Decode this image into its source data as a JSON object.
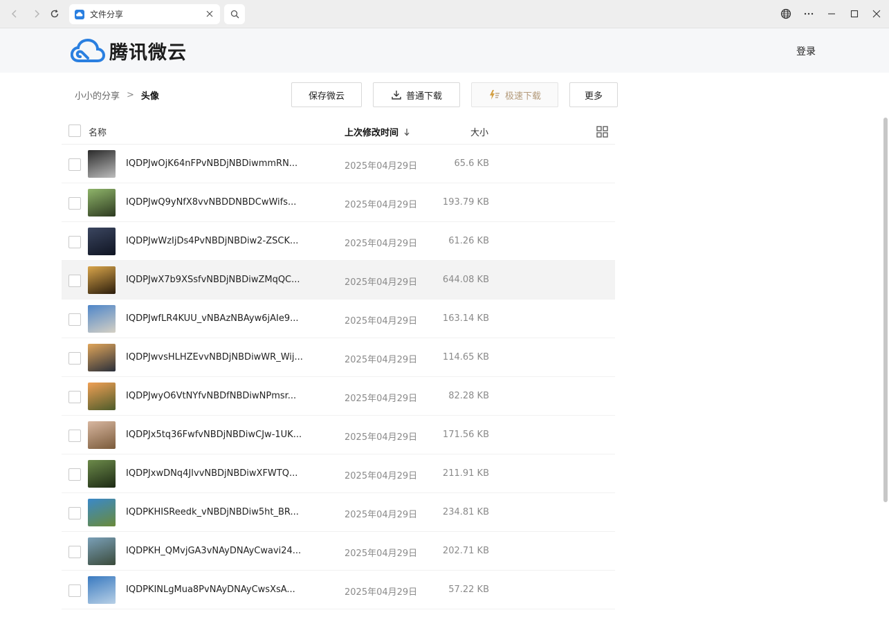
{
  "browser": {
    "tab_title": "文件分享"
  },
  "header": {
    "logo_text": "腾讯微云",
    "login_label": "登录"
  },
  "breadcrumb": {
    "parent": "小小的分享",
    "separator": ">",
    "current": "头像"
  },
  "toolbar": {
    "save_label": "保存微云",
    "download_label": "普通下载",
    "fast_download_label": "极速下载",
    "more_label": "更多"
  },
  "table": {
    "col_name": "名称",
    "col_date": "上次修改时间",
    "col_size": "大小",
    "rows": [
      {
        "name": "IQDPJwOjK64nFPvNBDjNBDiwmmRN...",
        "date": "2025年04月29日",
        "size": "65.6 KB",
        "thumb": [
          "#2a2a2a",
          "#bdbdbd"
        ]
      },
      {
        "name": "IQDPJwQ9yNfX8vvNBDDNBDCwWifs...",
        "date": "2025年04月29日",
        "size": "193.79 KB",
        "thumb": [
          "#8fb56a",
          "#2d3a20"
        ]
      },
      {
        "name": "IQDPJwWzIjDs4PvNBDjNBDiw2-ZSCK...",
        "date": "2025年04月29日",
        "size": "61.26 KB",
        "thumb": [
          "#3b4660",
          "#0f1422"
        ]
      },
      {
        "name": "IQDPJwX7b9XSsfvNBDjNBDiwZMqQC...",
        "date": "2025年04月29日",
        "size": "644.08 KB",
        "thumb": [
          "#d9a54a",
          "#2b1d0c"
        ]
      },
      {
        "name": "IQDPJwfLR4KUU_vNBAzNBAyw6jAIe9...",
        "date": "2025年04月29日",
        "size": "163.14 KB",
        "thumb": [
          "#4f86c9",
          "#d5d0c4"
        ]
      },
      {
        "name": "IQDPJwvsHLHZEvvNBDjNBDiwWR_Wij...",
        "date": "2025年04月29日",
        "size": "114.65 KB",
        "thumb": [
          "#e0a55a",
          "#2a2f3a"
        ]
      },
      {
        "name": "IQDPJwyO6VtNYfvNBDfNBDiwNPmsr...",
        "date": "2025年04月29日",
        "size": "82.28 KB",
        "thumb": [
          "#f0a055",
          "#4d5b2a"
        ]
      },
      {
        "name": "IQDPJx5tq36FwfvNBDjNBDiwCJw-1UK...",
        "date": "2025年04月29日",
        "size": "171.56 KB",
        "thumb": [
          "#d8b7a0",
          "#7a5a3a"
        ]
      },
      {
        "name": "IQDPJxwDNq4JIvvNBDjNBDiwXFWTQ...",
        "date": "2025年04月29日",
        "size": "211.91 KB",
        "thumb": [
          "#6c8a4a",
          "#1d2a14"
        ]
      },
      {
        "name": "IQDPKHISReedk_vNBDjNBDiw5ht_BR...",
        "date": "2025年04月29日",
        "size": "234.81 KB",
        "thumb": [
          "#3a89c9",
          "#6a8a3a"
        ]
      },
      {
        "name": "IQDPKH_QMvjGA3vNAyDNAyCwavi24...",
        "date": "2025年04月29日",
        "size": "202.71 KB",
        "thumb": [
          "#7aa0b8",
          "#3a4a3a"
        ]
      },
      {
        "name": "IQDPKINLgMua8PvNAyDNAyCwsXsA...",
        "date": "2025年04月29日",
        "size": "57.22 KB",
        "thumb": [
          "#3a7ac0",
          "#b8d0e6"
        ]
      }
    ]
  },
  "colors": {
    "brand_blue": "#2a7fe0",
    "fast_download": "#b39a7a"
  }
}
